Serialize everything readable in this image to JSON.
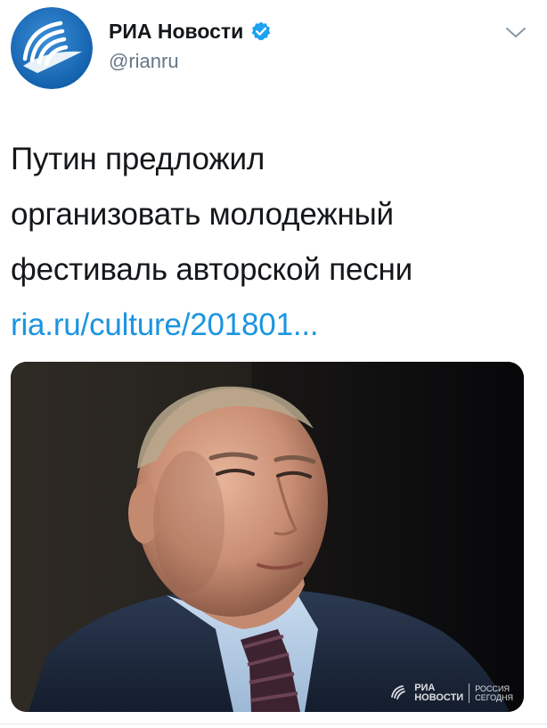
{
  "author": {
    "display_name": "РИА Новости",
    "handle": "@rianru",
    "verified": true,
    "avatar_icon": "ria-novosti-logo-icon"
  },
  "header": {
    "menu_icon": "chevron-down-icon"
  },
  "tweet": {
    "text_lines": [
      "Путин предложил",
      "организовать молодежный",
      "фестиваль авторской песни"
    ],
    "link": "ria.ru/culture/201801..."
  },
  "media": {
    "watermark": {
      "left_line1": "РИА",
      "left_line2": "НОВОСТИ",
      "right_line1": "РОССИЯ",
      "right_line2": "СЕГОДНЯ"
    }
  },
  "colors": {
    "brand_blue": "#1b95e0",
    "verified_blue": "#1da1f2",
    "text_primary": "#14171a",
    "text_secondary": "#657786"
  }
}
